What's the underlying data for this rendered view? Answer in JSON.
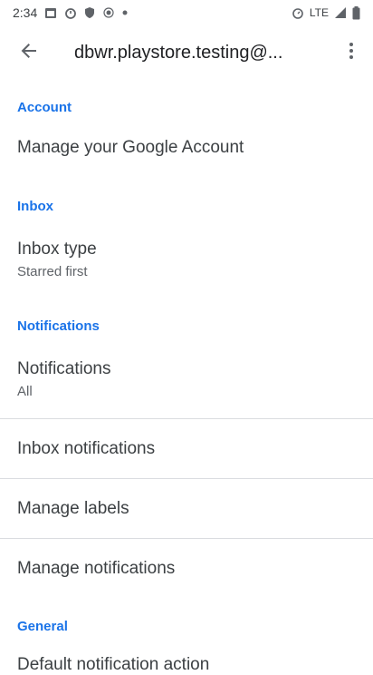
{
  "status_bar": {
    "time": "2:34",
    "network": "LTE"
  },
  "app_bar": {
    "title": "dbwr.playstore.testing@..."
  },
  "sections": {
    "account": {
      "header": "Account",
      "manage_google_account": "Manage your Google Account"
    },
    "inbox": {
      "header": "Inbox",
      "inbox_type_title": "Inbox type",
      "inbox_type_value": "Starred first"
    },
    "notifications": {
      "header": "Notifications",
      "notifications_title": "Notifications",
      "notifications_value": "All",
      "inbox_notifications": "Inbox notifications",
      "manage_labels": "Manage labels",
      "manage_notifications": "Manage notifications"
    },
    "general": {
      "header": "General",
      "default_action_partial": "Default notification action"
    }
  }
}
